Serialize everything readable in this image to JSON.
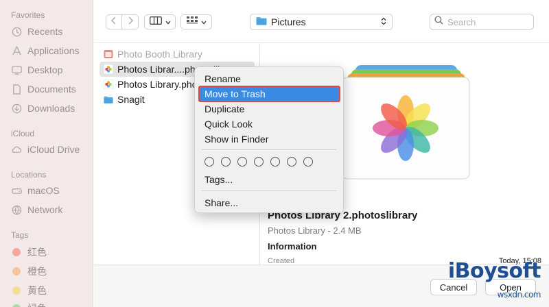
{
  "sidebar": {
    "favorites_label": "Favorites",
    "favorites": [
      {
        "label": "Recents",
        "icon": "clock-icon"
      },
      {
        "label": "Applications",
        "icon": "applications-icon"
      },
      {
        "label": "Desktop",
        "icon": "desktop-icon"
      },
      {
        "label": "Documents",
        "icon": "document-icon"
      },
      {
        "label": "Downloads",
        "icon": "download-icon"
      }
    ],
    "icloud_label": "iCloud",
    "icloud": [
      {
        "label": "iCloud Drive",
        "icon": "cloud-icon"
      }
    ],
    "locations_label": "Locations",
    "locations": [
      {
        "label": "macOS",
        "icon": "disk-icon"
      },
      {
        "label": "Network",
        "icon": "network-icon"
      }
    ],
    "tags_label": "Tags",
    "tags": [
      {
        "label": "红色",
        "color": "#f2a7a0"
      },
      {
        "label": "橙色",
        "color": "#f5c49a"
      },
      {
        "label": "黄色",
        "color": "#f5dc96"
      },
      {
        "label": "绿色",
        "color": "#a9dca4"
      }
    ]
  },
  "toolbar": {
    "path": "Pictures",
    "search_placeholder": "Search"
  },
  "files": [
    {
      "name": "Photo Booth Library",
      "state": "dim",
      "icon": "photo-booth-icon"
    },
    {
      "name": "Photos Librar....photoslibrary",
      "state": "selected",
      "icon": "photos-icon"
    },
    {
      "name": "Photos Library.photoslibrary",
      "state": "normal",
      "icon": "photos-icon"
    },
    {
      "name": "Snagit",
      "state": "normal",
      "icon": "folder-icon"
    }
  ],
  "context_menu": {
    "rename": "Rename",
    "move_to_trash": "Move to Trash",
    "duplicate": "Duplicate",
    "quick_look": "Quick Look",
    "show_in_finder": "Show in Finder",
    "tag_circle_count": 7,
    "tags": "Tags...",
    "share": "Share..."
  },
  "preview": {
    "title": "Photos Library 2.photoslibrary",
    "subtitle": "Photos Library - 2.4 MB",
    "info_heading": "Information",
    "created_label": "Created",
    "created_value": "Today, 15:08"
  },
  "buttons": {
    "cancel": "Cancel",
    "open": "Open"
  },
  "watermark": {
    "brand": "iBoysoft",
    "domain": "wsxdn.com"
  },
  "colors": {
    "sidebar_bg": "#f3e9e9",
    "highlight": "#3a8be4",
    "highlight_border": "#e0473f",
    "folder": "#4aa3df"
  }
}
